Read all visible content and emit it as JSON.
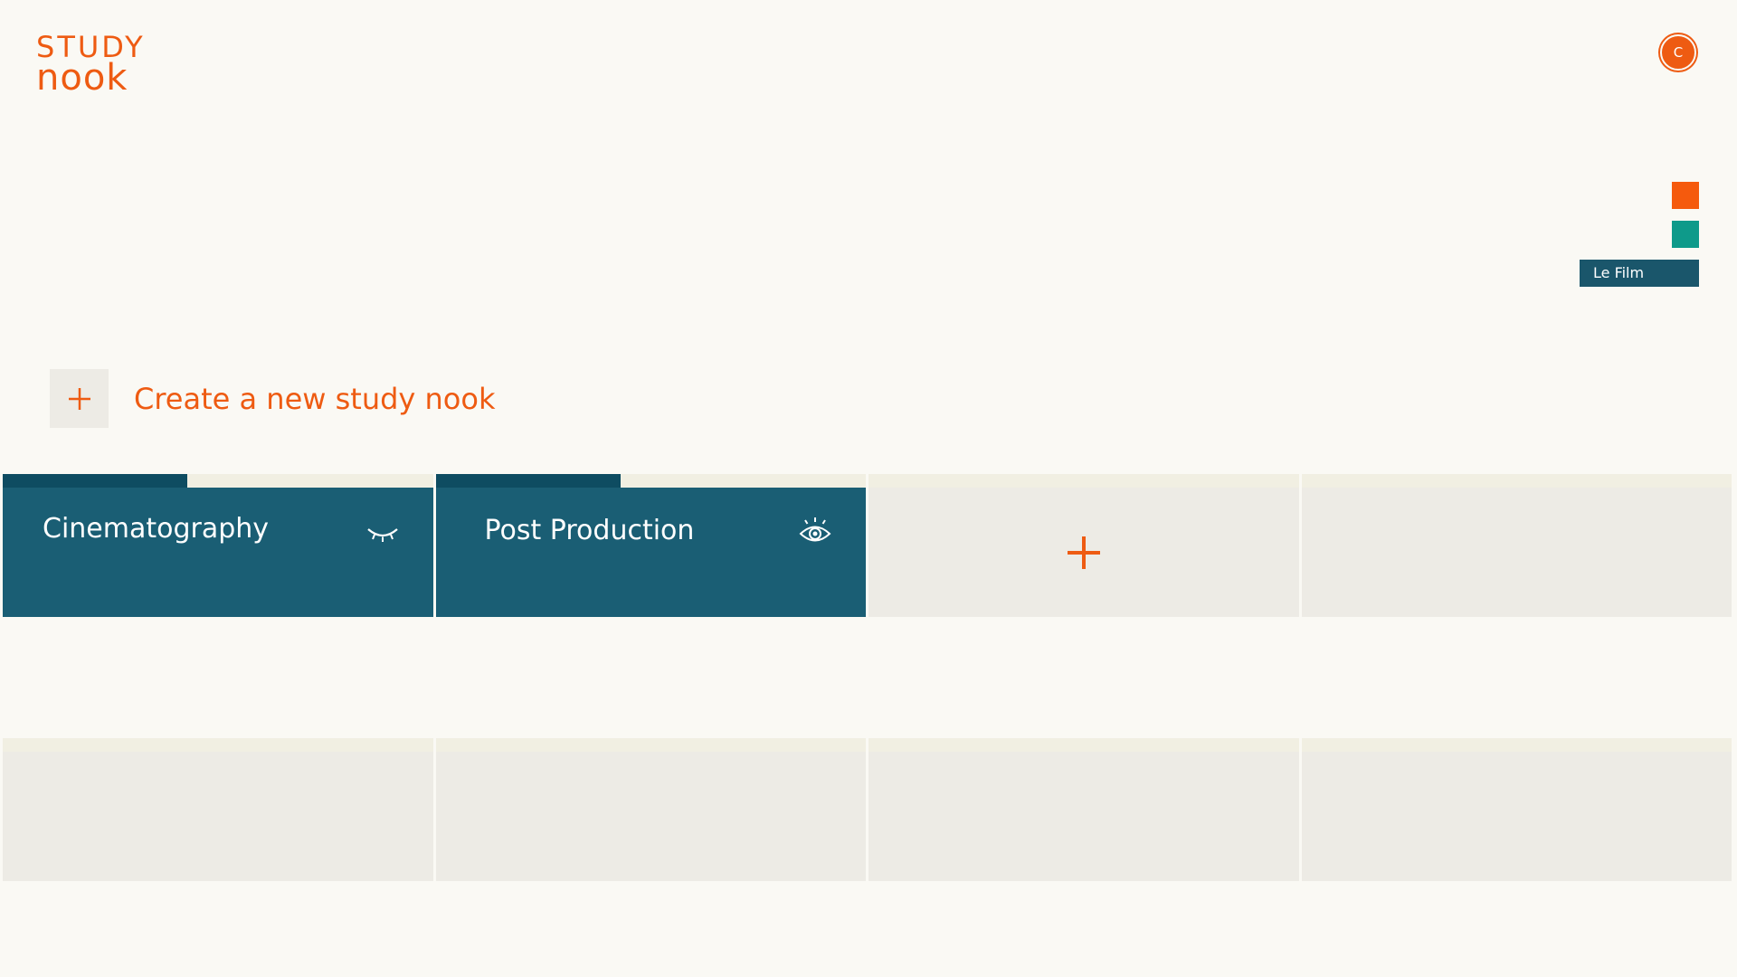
{
  "logo": {
    "line1": "STUDY",
    "line2": "nook"
  },
  "user": {
    "initial": "C"
  },
  "swatches": {
    "orange": "#f55a0d",
    "teal": "#0e9a8a"
  },
  "film_tag": "Le Film",
  "create": {
    "label": "Create a new study nook",
    "icon": "plus-icon"
  },
  "nooks": [
    {
      "title": "Cinematography",
      "icon": "eye-closed-icon",
      "progress": 0.43
    },
    {
      "title": "Post Production",
      "icon": "eye-open-icon",
      "progress": 0.43
    }
  ],
  "add_tile_icon": "plus-icon",
  "colors": {
    "accent": "#ee5b12",
    "tile_filled": "#1a5e74",
    "tile_progress": "#0e4c61",
    "tile_empty": "#edebe5"
  }
}
